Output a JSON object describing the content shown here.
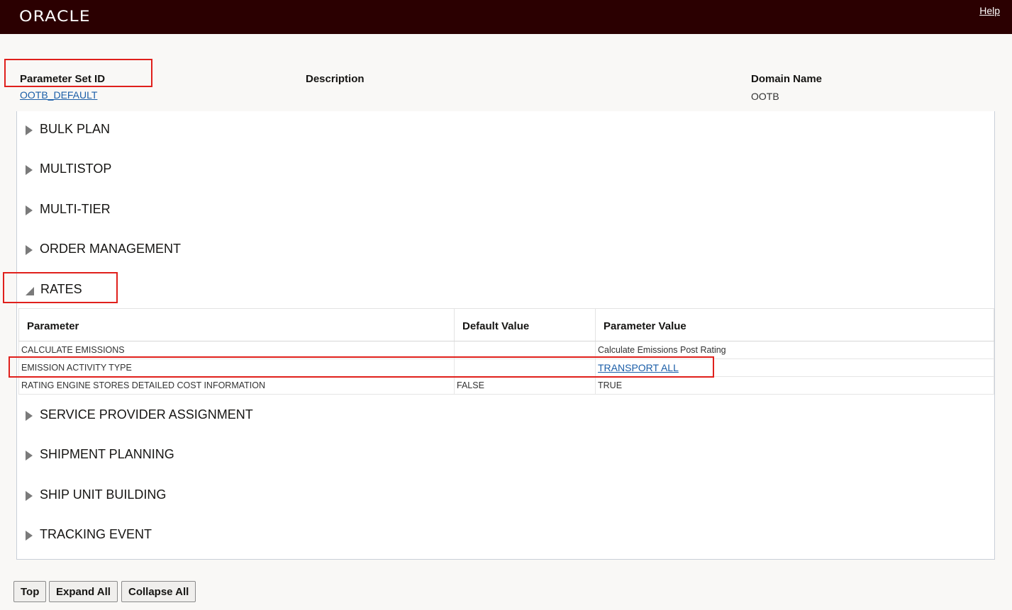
{
  "app": {
    "logo_text": "ORACLE",
    "help_label": "Help"
  },
  "header": {
    "parameter_set_id_label": "Parameter Set ID",
    "parameter_set_id_value": "OOTB_DEFAULT",
    "description_label": "Description",
    "domain_name_label": "Domain Name",
    "domain_name_value": "OOTB"
  },
  "sections": {
    "bulk_plan": "BULK PLAN",
    "multistop": "MULTISTOP",
    "multi_tier": "MULTI-TIER",
    "order_management": "ORDER MANAGEMENT",
    "rates": "RATES",
    "service_provider_assignment": "SERVICE PROVIDER ASSIGNMENT",
    "shipment_planning": "SHIPMENT PLANNING",
    "ship_unit_building": "SHIP UNIT BUILDING",
    "tracking_event": "TRACKING EVENT"
  },
  "rates_table": {
    "columns": [
      "Parameter",
      "Default Value",
      "Parameter Value"
    ],
    "rows": [
      {
        "parameter": "CALCULATE EMISSIONS",
        "default_value": "",
        "parameter_value": "Calculate Emissions Post Rating"
      },
      {
        "parameter": "EMISSION ACTIVITY TYPE",
        "default_value": "",
        "parameter_value": "TRANSPORT ALL"
      },
      {
        "parameter": "RATING ENGINE STORES DETAILED COST INFORMATION",
        "default_value": "FALSE",
        "parameter_value": "TRUE"
      }
    ]
  },
  "buttons": {
    "top": "Top",
    "expand_all": "Expand All",
    "collapse_all": "Collapse All"
  },
  "colors": {
    "topbar": "#2b0001",
    "link": "#1b5ea8",
    "highlight": "#e0201c"
  }
}
